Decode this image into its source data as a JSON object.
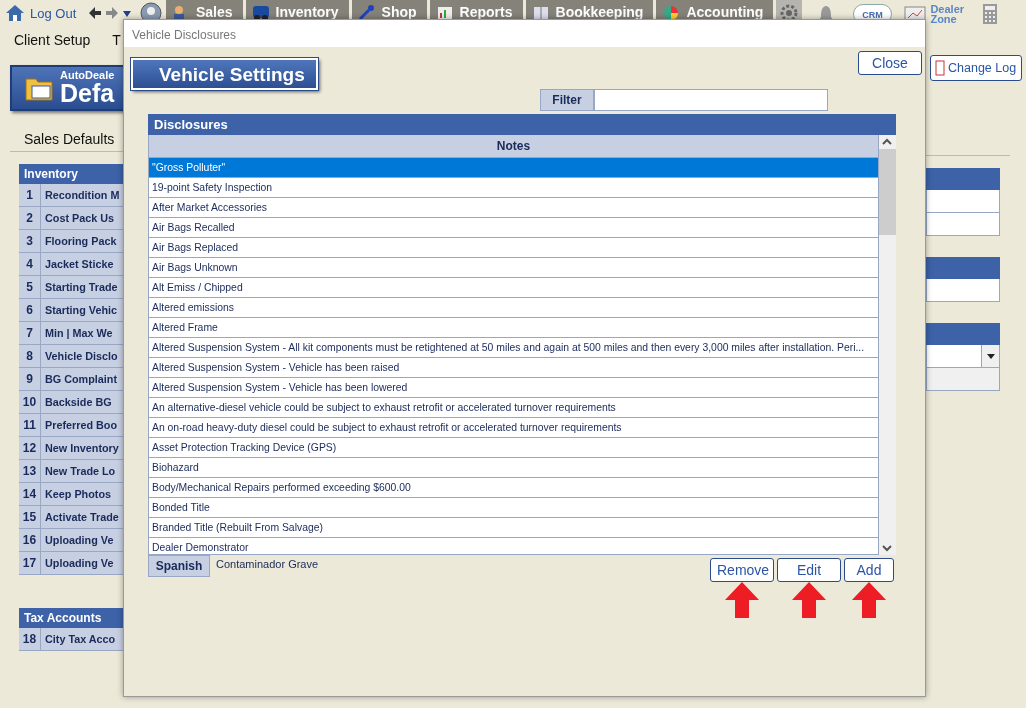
{
  "nav": {
    "log_out": "Log Out",
    "tabs": [
      {
        "label": "Sales"
      },
      {
        "label": "Inventory"
      },
      {
        "label": "Shop"
      },
      {
        "label": "Reports"
      },
      {
        "label": "Bookkeeping"
      },
      {
        "label": "Accounting"
      }
    ],
    "crm": "CRM",
    "dealer_zone": [
      "Dealer",
      "Zone"
    ]
  },
  "menu": [
    "Client Setup",
    "T"
  ],
  "banner": {
    "line1": "AutoDeale",
    "line2": "Defa"
  },
  "section_title": "Sales Defaults",
  "inventory_table": {
    "title": "Inventory",
    "rows": [
      {
        "number": "1",
        "name": "Recondition M"
      },
      {
        "number": "2",
        "name": "Cost Pack Us"
      },
      {
        "number": "3",
        "name": "Flooring Pack"
      },
      {
        "number": "4",
        "name": "Jacket Sticke"
      },
      {
        "number": "5",
        "name": "Starting Trade"
      },
      {
        "number": "6",
        "name": "Starting Vehic"
      },
      {
        "number": "7",
        "name": "Min | Max We"
      },
      {
        "number": "8",
        "name": "Vehicle Disclo"
      },
      {
        "number": "9",
        "name": "BG Complaint"
      },
      {
        "number": "10",
        "name": "Backside BG"
      },
      {
        "number": "11",
        "name": "Preferred Boo"
      },
      {
        "number": "12",
        "name": "New Inventory"
      },
      {
        "number": "13",
        "name": "New Trade Lo"
      },
      {
        "number": "14",
        "name": "Keep Photos"
      },
      {
        "number": "15",
        "name": "Activate Trade"
      },
      {
        "number": "16",
        "name": "Uploading Ve"
      },
      {
        "number": "17",
        "name": "Uploading Ve"
      }
    ]
  },
  "tax_table": {
    "title": "Tax Accounts",
    "rows": [
      {
        "number": "18",
        "name": "City Tax Acco"
      }
    ]
  },
  "change_log": "Change Log",
  "dialog": {
    "title": "Vehicle Disclosures",
    "heading": "Vehicle Settings",
    "close": "Close",
    "filter_label": "Filter",
    "section": "Disclosures",
    "column": "Notes",
    "rows": [
      {
        "note": "\"Gross Polluter\"",
        "selected": true
      },
      {
        "note": "19-point Safety Inspection",
        "selected": false
      },
      {
        "note": "After Market Accessories",
        "selected": false
      },
      {
        "note": "Air Bags Recalled",
        "selected": false
      },
      {
        "note": "Air Bags Replaced",
        "selected": false
      },
      {
        "note": "Air Bags Unknown",
        "selected": false
      },
      {
        "note": "Alt Emiss / Chipped",
        "selected": false
      },
      {
        "note": "Altered emissions",
        "selected": false
      },
      {
        "note": "Altered Frame",
        "selected": false
      },
      {
        "note": "Altered Suspension System - All kit components must be retightened at 50 miles and again at 500 miles and then every 3,000 miles after installation. Peri...",
        "selected": false
      },
      {
        "note": "Altered Suspension System - Vehicle has been raised",
        "selected": false
      },
      {
        "note": "Altered Suspension System - Vehicle has been lowered",
        "selected": false
      },
      {
        "note": "An alternative-diesel vehicle could be subject to exhaust retrofit or accelerated turnover requirements",
        "selected": false
      },
      {
        "note": "An on-road heavy-duty diesel could be subject to exhaust retrofit or accelerated turnover requirements",
        "selected": false
      },
      {
        "note": "Asset Protection Tracking Device (GPS)",
        "selected": false
      },
      {
        "note": "Biohazard",
        "selected": false
      },
      {
        "note": "Body/Mechanical Repairs performed exceeding $600.00",
        "selected": false
      },
      {
        "note": "Bonded Title",
        "selected": false
      },
      {
        "note": "Branded Title (Rebuilt From Salvage)",
        "selected": false
      },
      {
        "note": "Dealer Demonstrator",
        "selected": false
      }
    ],
    "spanish_label": "Spanish",
    "spanish_text": "Contaminador Grave",
    "buttons": [
      "Remove",
      "Edit",
      "Add"
    ]
  }
}
